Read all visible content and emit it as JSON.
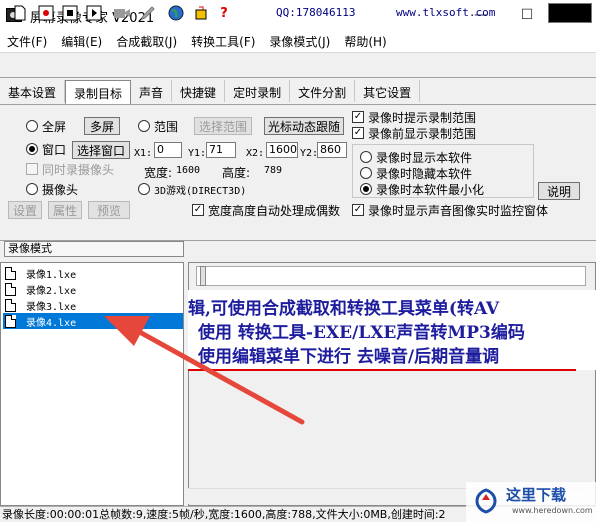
{
  "window": {
    "title": "屏幕录像专家 V2021",
    "minimize": "—",
    "maximize": "☐",
    "close": "✕"
  },
  "menu": [
    "文件(F)",
    "编辑(E)",
    "合成截取(J)",
    "转换工具(F)",
    "录像模式(J)",
    "帮助(H)"
  ],
  "toolbar": {
    "qq": "QQ:178046113",
    "site": "www.tlxsoft.com"
  },
  "tabs": [
    "基本设置",
    "录制目标",
    "声音",
    "快捷键",
    "定时录制",
    "文件分割",
    "其它设置"
  ],
  "active_tab": "录制目标",
  "target": {
    "fullscreen": "全屏",
    "multiscreen": "多屏",
    "range": "范围",
    "select_range": "选择范围",
    "cursor_follow": "光标动态跟随",
    "window": "窗口",
    "select_window": "选择窗口",
    "x1_label": "X1:",
    "x1": "0",
    "y1_label": "Y1:",
    "y1": "71",
    "x2_label": "X2:",
    "x2": "1600",
    "y2_label": "Y2:",
    "y2": "860",
    "width_label": "宽度:",
    "width": "1600",
    "height_label": "高度:",
    "height": "789",
    "camera_sync": "同时录摄像头",
    "camera": "摄像头",
    "game3d": "3D游戏(DIRECT3D)",
    "settings": "设置",
    "props": "属性",
    "preview": "预览",
    "auto_even": "宽度高度自动处理成偶数",
    "hint_range": "录像时提示录制范围",
    "show_before": "录像前显示录制范围",
    "show_sw": "录像时显示本软件",
    "hide_sw": "录像时隐藏本软件",
    "min_sw": "录像时本软件最小化",
    "explain": "说明",
    "audio_monitor": "录像时显示声音图像实时监控窗体"
  },
  "mode_tab": "录像模式",
  "files": [
    "录像1.lxe",
    "录像2.lxe",
    "录像3.lxe",
    "录像4.lxe"
  ],
  "selected_file": 3,
  "banner": [
    "辑,可使用合成截取和转换工具菜单(转AV",
    "使用 转换工具-EXE/LXE声音转MP3编码",
    "使用编辑菜单下进行 去噪音/后期音量调"
  ],
  "status": "录像长度:00:00:01总帧数:9,速度:5帧/秒,宽度:1600,高度:788,文件大小:0MB,创建时间:2",
  "watermark": {
    "title": "这里下载",
    "url": "www.heredown.com"
  },
  "colors": {
    "accent": "#0078d7",
    "banner_text": "#1d1d9e",
    "arrow": "#e5483a"
  }
}
